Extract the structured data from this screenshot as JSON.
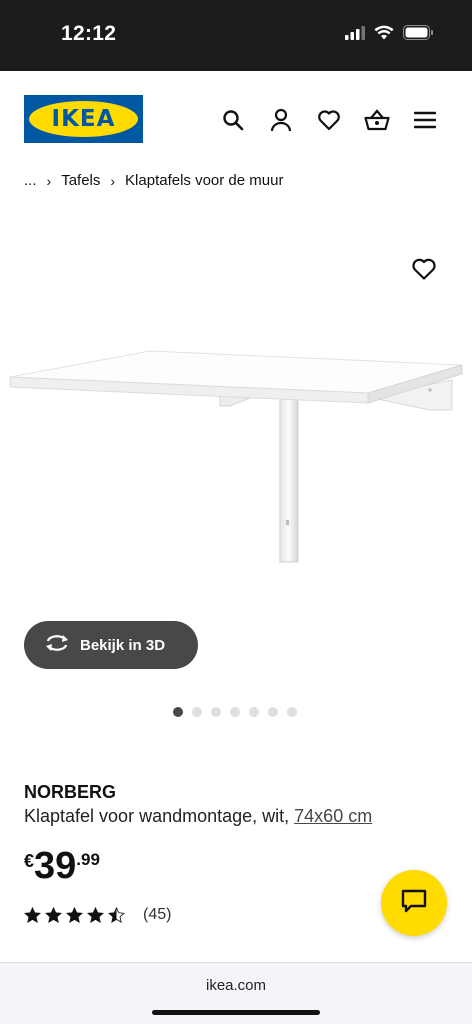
{
  "status_bar": {
    "time": "12:12"
  },
  "header": {
    "logo_text": "IKEA",
    "icons": [
      "search-icon",
      "user-icon",
      "heart-icon",
      "basket-icon",
      "menu-icon"
    ]
  },
  "breadcrumb": {
    "ellipsis": "...",
    "items": [
      "Tafels",
      "Klaptafels voor de muur"
    ]
  },
  "gallery": {
    "view_3d_label": "Bekijk in 3D",
    "image_count": 7,
    "active_index": 0
  },
  "product": {
    "name": "NORBERG",
    "description": "Klaptafel voor wandmontage, wit, ",
    "size": "74x60 cm",
    "price_currency": "€",
    "price_integer": "39",
    "price_decimal": ".99",
    "rating_value": 4.5,
    "rating_max": 5,
    "rating_count": "(45)"
  },
  "browser": {
    "url": "ikea.com"
  },
  "colors": {
    "brand_blue": "#0058a3",
    "brand_yellow": "#ffdb00",
    "dark_button": "#484848"
  }
}
